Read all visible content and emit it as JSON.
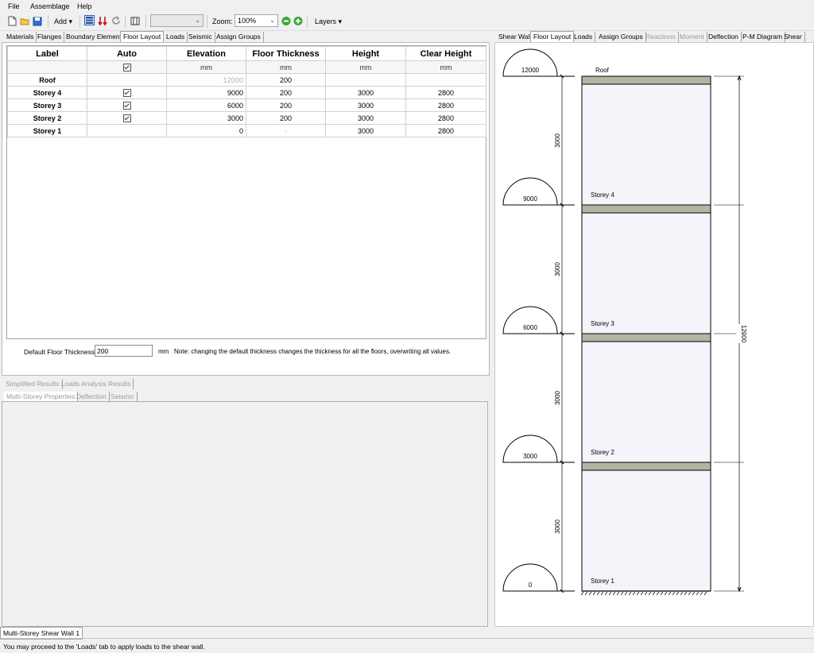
{
  "menu": [
    "File",
    "Assemblage",
    "Help"
  ],
  "toolbar": {
    "add_label": "Add",
    "zoom_label": "Zoom:",
    "zoom_value": "100%",
    "layers_label": "Layers"
  },
  "left_tabs": [
    "Materials",
    "Flanges",
    "Boundary Elements",
    "Floor Layout",
    "Loads",
    "Seismic",
    "Assign Groups"
  ],
  "grid": {
    "headers": [
      "Label",
      "Auto",
      "Elevation",
      "Floor Thickness",
      "Height",
      "Clear Height"
    ],
    "units": [
      "",
      "",
      "mm",
      "mm",
      "mm",
      "mm"
    ],
    "rows": [
      {
        "label": "Roof",
        "auto": false,
        "elevation": "12000",
        "thickness": "200",
        "height": "",
        "clear": ""
      },
      {
        "label": "Storey 4",
        "auto": true,
        "elevation": "9000",
        "thickness": "200",
        "height": "3000",
        "clear": "2800"
      },
      {
        "label": "Storey 3",
        "auto": true,
        "elevation": "6000",
        "thickness": "200",
        "height": "3000",
        "clear": "2800"
      },
      {
        "label": "Storey 2",
        "auto": true,
        "elevation": "3000",
        "thickness": "200",
        "height": "3000",
        "clear": "2800"
      },
      {
        "label": "Storey 1",
        "auto": false,
        "elevation": "0",
        "thickness": "-",
        "height": "3000",
        "clear": "2800"
      }
    ]
  },
  "default_thickness": {
    "label": "Default Floor Thickness:",
    "value": "200",
    "unit": "mm",
    "note": "Note: changing the default thickness changes the thickness for all the floors, overwriting all values."
  },
  "results_tabs": [
    "Simplified Results",
    "Loads Analysis Results"
  ],
  "results_subtabs": [
    "Multi-Storey Properties",
    "Deflection",
    "Seismic"
  ],
  "right_tabs": [
    "Shear Wall",
    "Floor Layout",
    "Loads",
    "Assign Groups",
    "Reactions",
    "Moment",
    "Deflection",
    "P-M Diagram",
    "Shear"
  ],
  "diagram": {
    "levels": [
      {
        "elevation": "12000",
        "name": "Roof"
      },
      {
        "elevation": "9000",
        "name": "Storey 4"
      },
      {
        "elevation": "6000",
        "name": "Storey 3"
      },
      {
        "elevation": "3000",
        "name": "Storey 2"
      },
      {
        "elevation": "0",
        "name": "Storey 1"
      }
    ],
    "storey_dims": [
      "3000",
      "3000",
      "3000",
      "3000"
    ],
    "total_dim": "12000"
  },
  "document_tab": "Multi-Storey Shear Wall 1",
  "status": "You may proceed to the 'Loads' tab to apply loads to the shear wall."
}
